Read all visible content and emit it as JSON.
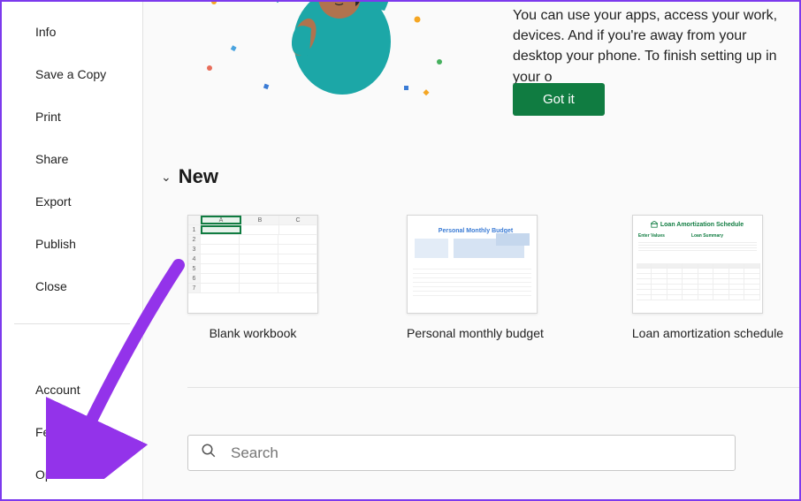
{
  "sidebar": {
    "primary": [
      {
        "label": "Info"
      },
      {
        "label": "Save a Copy"
      },
      {
        "label": "Print"
      },
      {
        "label": "Share"
      },
      {
        "label": "Export"
      },
      {
        "label": "Publish"
      },
      {
        "label": "Close"
      }
    ],
    "secondary": [
      {
        "label": "Account"
      },
      {
        "label": "Feedback"
      },
      {
        "label": "Options"
      }
    ]
  },
  "banner": {
    "text": "You can use your apps, access your work, devices. And if you're away from your desktop your phone. To finish setting up in your o",
    "button": "Got it"
  },
  "new_section": {
    "title": "New",
    "templates": [
      {
        "label": "Blank workbook"
      },
      {
        "label": "Personal monthly budget"
      },
      {
        "label": "Loan amortization schedule"
      }
    ],
    "budget_preview_title": "Personal Monthly Budget",
    "loan_preview_title": "Loan Amortization Schedule",
    "loan_preview_sections": {
      "left": "Enter Values",
      "right": "Loan Summary"
    }
  },
  "search": {
    "placeholder": "Search"
  },
  "colors": {
    "accent": "#107C41",
    "annotation": "#9333ea"
  }
}
